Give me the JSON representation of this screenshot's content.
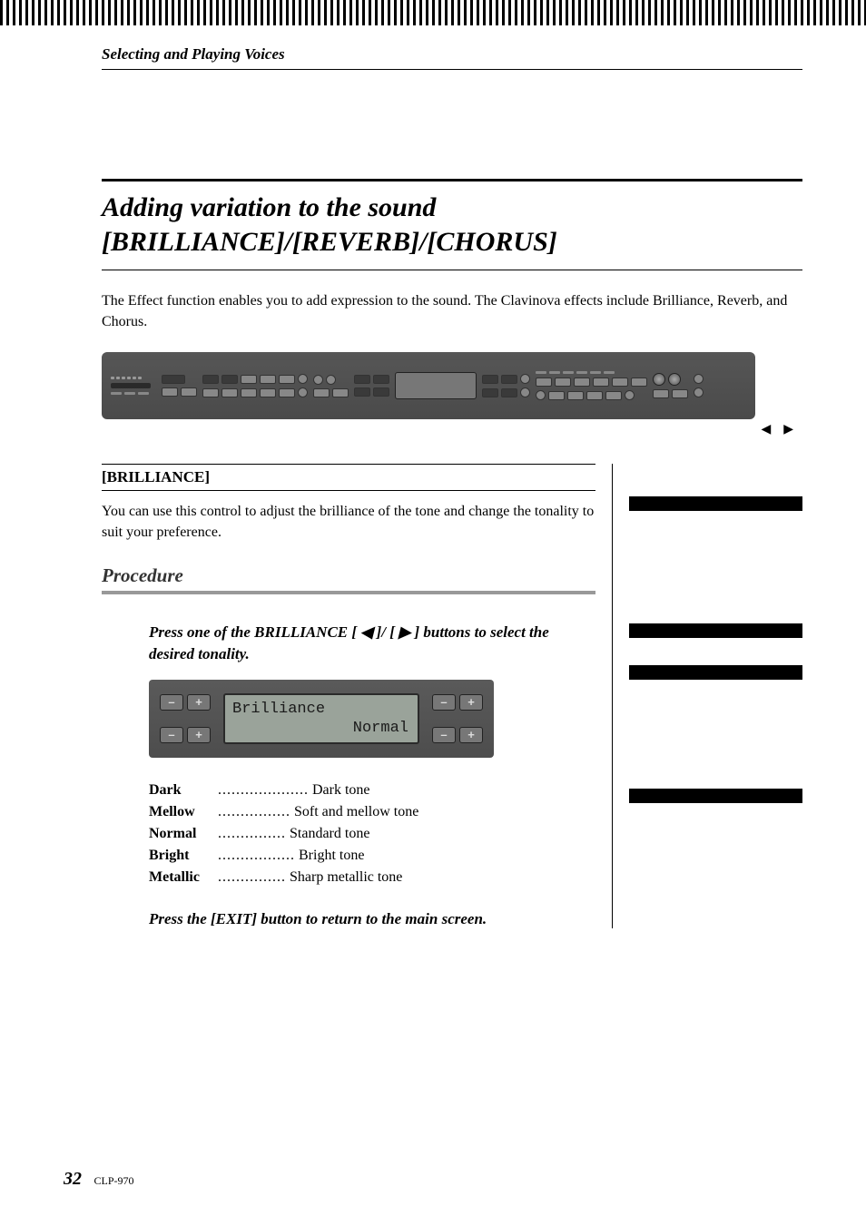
{
  "section_header": "Selecting and Playing Voices",
  "title_line1": "Adding variation to the sound",
  "title_line2": "[BRILLIANCE]/[REVERB]/[CHORUS]",
  "intro": "The Effect function enables you to add expression to the sound. The Clavinova effects include Brilliance, Reverb, and Chorus.",
  "callout_left_tri": "◀",
  "callout_right_tri": "▶",
  "brilliance": {
    "heading": "[BRILLIANCE]",
    "desc": "You can use this control to adjust the brilliance of the tone and change the tonality to suit your preference.",
    "procedure_label": "Procedure",
    "step1": "Press one of the BRILLIANCE [ ◀ ]/ [ ▶ ] buttons to select the desired tonality.",
    "lcd_title": "Brilliance",
    "lcd_value": "Normal",
    "minus": "–",
    "plus": "+",
    "tones": [
      {
        "name": "Dark",
        "dots": "....................",
        "desc": "Dark tone"
      },
      {
        "name": "Mellow",
        "dots": "................",
        "desc": "Soft and mellow tone"
      },
      {
        "name": "Normal",
        "dots": "...............",
        "desc": "Standard tone"
      },
      {
        "name": "Bright",
        "dots": ".................",
        "desc": "Bright tone"
      },
      {
        "name": "Metallic",
        "dots": "...............",
        "desc": "Sharp metallic tone"
      }
    ],
    "step2": "Press the [EXIT] button to return to the main screen."
  },
  "footer": {
    "page": "32",
    "model": "CLP-970"
  }
}
